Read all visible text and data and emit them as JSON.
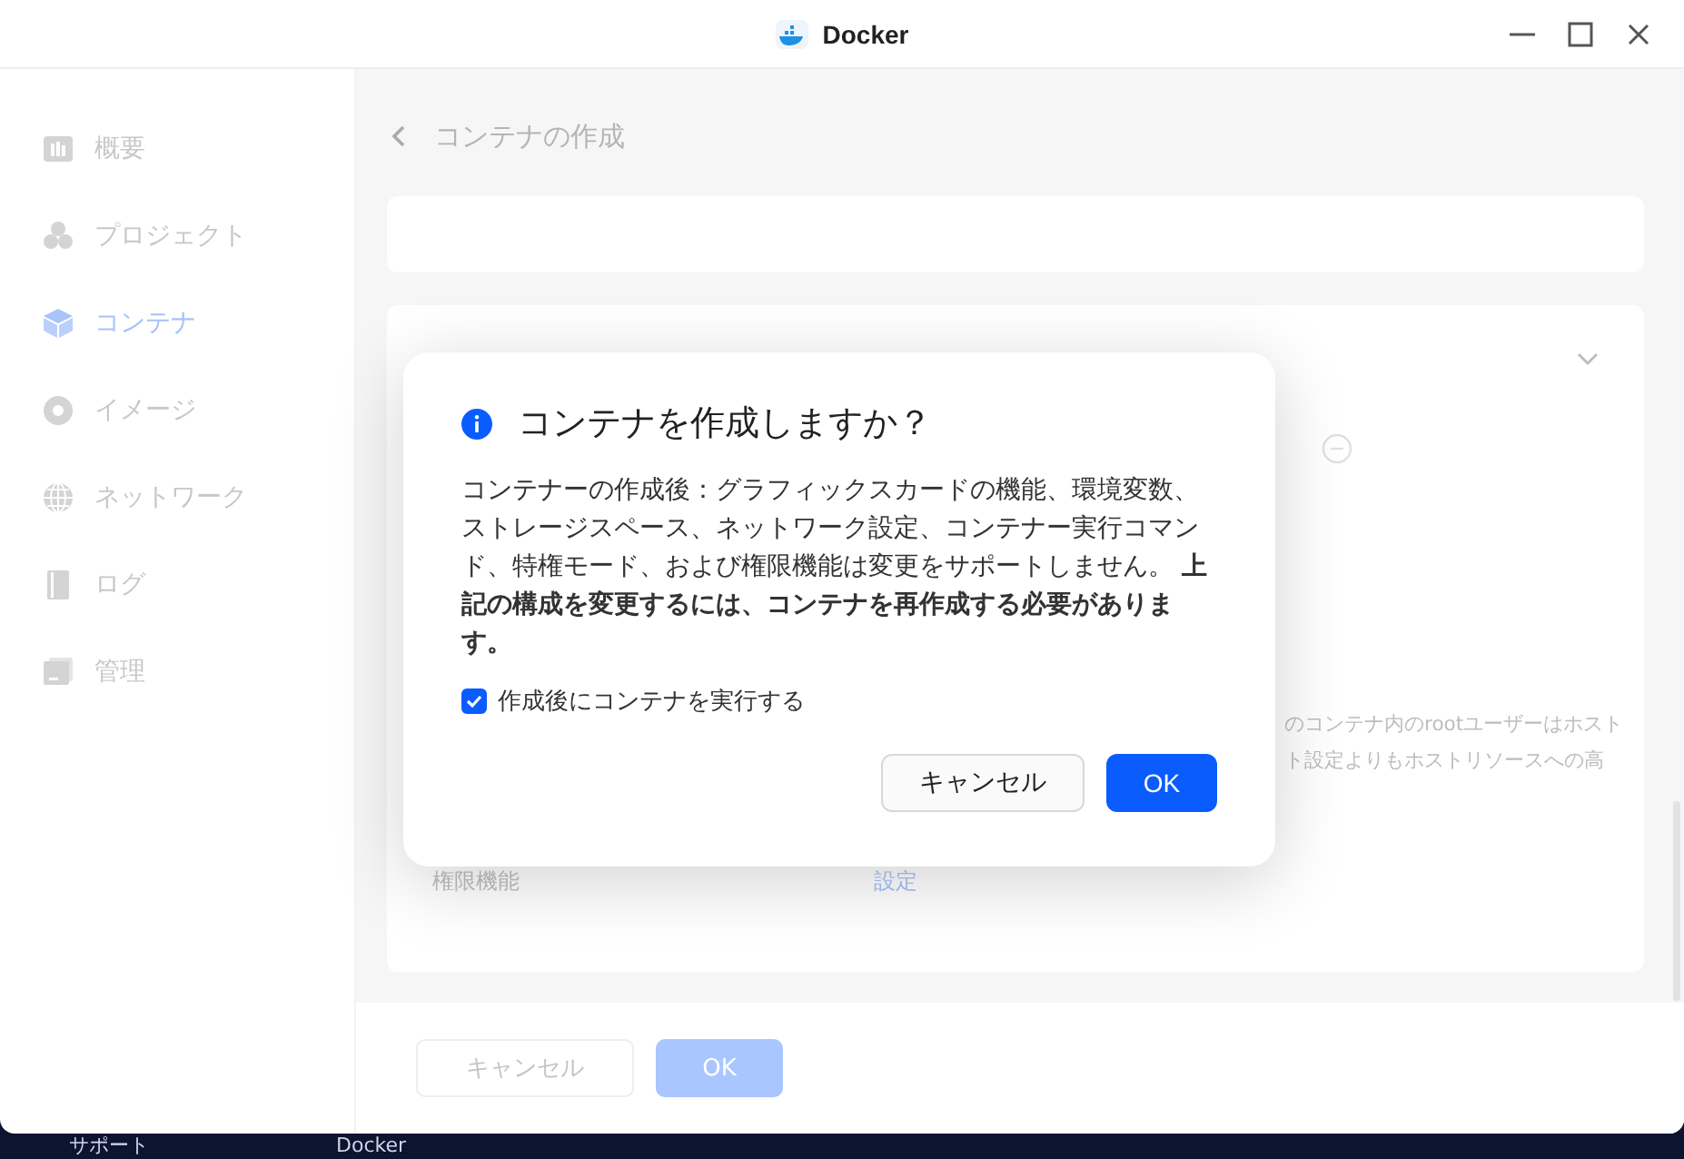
{
  "window": {
    "title": "Docker"
  },
  "sidebar": {
    "items": [
      {
        "label": "概要",
        "selected": false
      },
      {
        "label": "プロジェクト",
        "selected": false
      },
      {
        "label": "コンテナ",
        "selected": true
      },
      {
        "label": "イメージ",
        "selected": false
      },
      {
        "label": "ネットワーク",
        "selected": false
      },
      {
        "label": "ログ",
        "selected": false
      },
      {
        "label": "管理",
        "selected": false
      }
    ]
  },
  "page": {
    "title": "コンテナの作成",
    "settings": {
      "hint_lines": [
        "のコンテナ内のrootユーザーはホスト",
        "ト設定よりもホストリソースへの高"
      ],
      "permission_label": "権限機能",
      "permission_link": "設定"
    },
    "footer": {
      "cancel": "キャンセル",
      "ok": {
        "label": "OK",
        "disabled": true
      }
    }
  },
  "dialog": {
    "title": "コンテナを作成しますか？",
    "message": "コンテナーの作成後：グラフィックスカードの機能、環境変数、ストレージスペース、ネットワーク設定、コンテナー実行コマンド、特権モード、および権限機能は変更をサポートしません。 **上記の構成を変更するには、コンテナを再作成する必要があります。**",
    "checkbox": {
      "label": "作成後にコンテナを実行する",
      "checked": true
    },
    "buttons": {
      "cancel": "キャンセル",
      "ok": "OK"
    }
  },
  "desktop": {
    "labels": [
      "サポート",
      "Docker"
    ]
  }
}
